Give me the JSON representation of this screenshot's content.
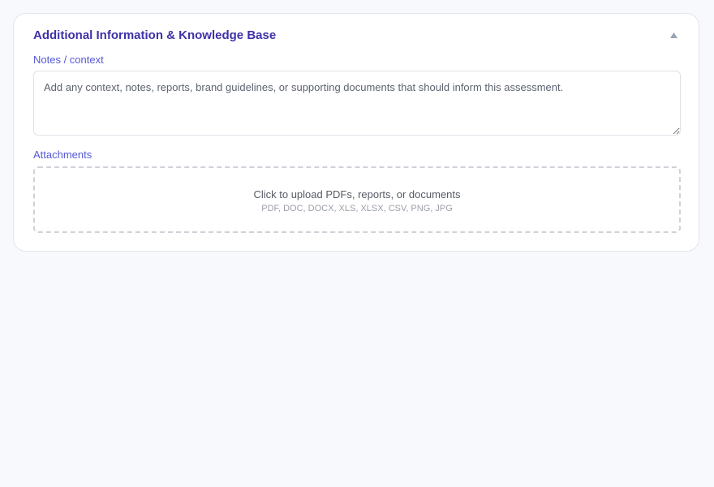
{
  "section": {
    "title": "Additional Information & Knowledge Base",
    "toggle_icon": "chevron-up-icon",
    "notes": {
      "label": "Notes / context",
      "placeholder": "Add any context, notes, reports, brand guidelines, or supporting documents that should inform this assessment.",
      "value": ""
    },
    "attachments": {
      "label": "Attachments",
      "upload_prompt": "Click to upload PDFs, reports, or documents",
      "accepted_types": "PDF, DOC, DOCX, XLS, XLSX, CSV, PNG, JPG",
      "upload_icon": "upload-icon"
    }
  },
  "colors": {
    "background": "#f8f9fc",
    "title": "#3d31a8",
    "label": "#5458d6",
    "border": "#dfe1e7",
    "dashed_border": "#cfd2d9"
  }
}
